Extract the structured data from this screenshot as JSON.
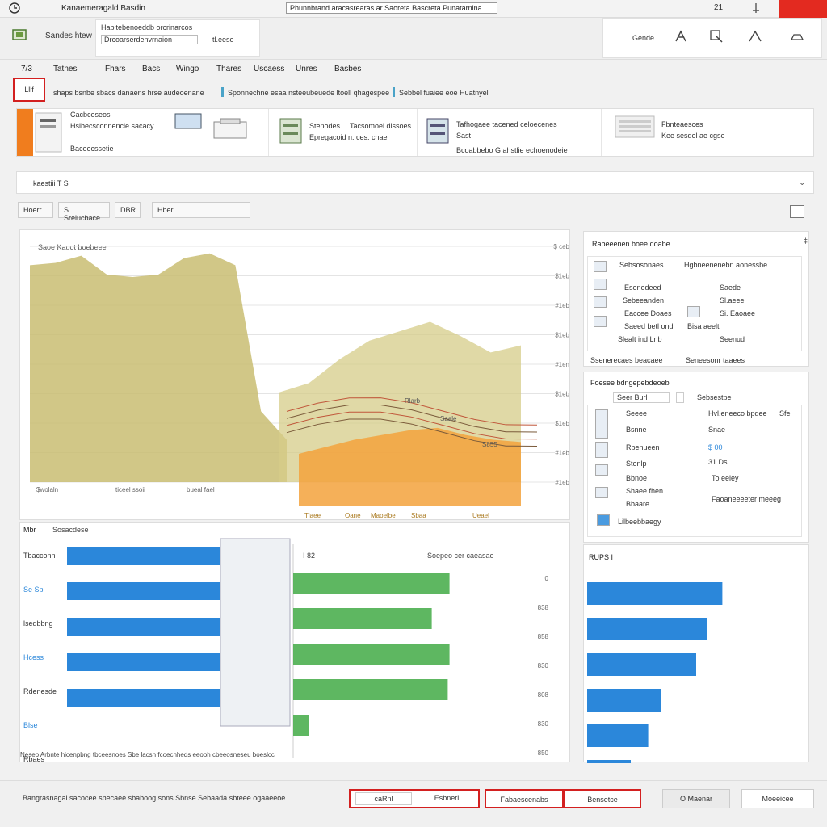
{
  "titlebar": {
    "title": "Kanaemeragald Basdin",
    "doc": "Phunnbrand aracasrearas ar Saoreta Bascreta Punatarnina",
    "num": "21"
  },
  "toolbar": {
    "label": "Sandes htew",
    "search_line1": "Habitebenoeddb orcrinarcos",
    "search_field": "Drcoarserdenvrnaion",
    "search_value": "tl.eese",
    "right_label": "Gende",
    "tools": [
      "pin-tool",
      "crop-tool",
      "angle-tool",
      "shape-tool"
    ]
  },
  "menu": [
    "Tatnes",
    "Fhars",
    "Bacs",
    "Wingo",
    "Thares",
    "Uscaess",
    "Unres",
    "Basbes"
  ],
  "menu_icon": "7/3",
  "ribbon": {
    "button": "Lllf",
    "seg1": "shaps bsnbe sbacs danaens hrse audeoenane",
    "seg2": "Sponnechne esaa nsteeubeuede ltoell qhagespee",
    "seg3": "Sebbel fuaiee eoe Huatnyel"
  },
  "cards": [
    {
      "t1": "Cacbceseos",
      "t2": "Hslbecsconnencle sacacy",
      "t3": "Baceecssetie"
    },
    {
      "t1": "Stenodes",
      "t2": "Tacsomoel dissoes",
      "t3": "Epregacoid n. ces. cnaei"
    },
    {
      "t1": "Tafhogaee tacened celoecenes",
      "t2": "Sast",
      "t3": "Bcoabbebo G ahstlie echoenodeie"
    },
    {
      "t1": "Fbnteaesces",
      "t2": "Kee sesdel ae cgse"
    }
  ],
  "section": {
    "title": "kaestiii T S"
  },
  "filters": [
    {
      "label": "Hoerr"
    },
    {
      "label": "S Srelucbace"
    },
    {
      "label": "DBR"
    },
    {
      "label": "Hber"
    }
  ],
  "mainchart": {
    "title": "Saoe  Kauot  boebeee",
    "yticks": [
      "$ ceb",
      "$1eb",
      "#1eb",
      "$1eb",
      "#1en",
      "$1eb",
      "$1eb",
      "#1eb",
      "#1eb"
    ],
    "xlabels": [
      "$wolaln",
      "ticeel ssoii",
      "bueal fael"
    ],
    "xlabels2": [
      "Tlaee",
      "Oane",
      "Maoelbe",
      "Sbaa",
      "Ueael"
    ],
    "annot1": "Rlarb",
    "annot2": "Saale",
    "annot3": "S855",
    "series_area1": [
      0.92,
      0.93,
      0.96,
      0.88,
      0.87,
      0.88,
      0.95,
      0.97,
      0.92,
      0.3,
      0.18
    ],
    "series_area2": [
      0.38,
      0.42,
      0.52,
      0.6,
      0.64,
      0.68,
      0.62,
      0.55,
      0.58
    ],
    "series_orange": [
      0.12,
      0.15,
      0.18,
      0.2,
      0.22,
      0.23,
      0.2,
      0.18,
      0.17
    ]
  },
  "panel1": {
    "title": "Rabeeenen boee doabe",
    "rows": [
      {
        "a": "Sebsosonaes",
        "b": "Hgbneenenebn aonessbe"
      },
      {
        "a": "Esenedeed",
        "b": "Saede"
      },
      {
        "a": "Sebeeanden",
        "b": "Sl.aeee"
      },
      {
        "a": "Eaccee Doaes",
        "b": "Si. Eaoaee"
      },
      {
        "a": "Saeed betl ond",
        "b": "Bisa aeelt"
      },
      {
        "a": "Slealt ind Lnb",
        "b": "Seenud"
      }
    ],
    "foot_a": "Ssenerecaes beacaee",
    "foot_b": "Seneesonr taaees"
  },
  "panel2": {
    "title": "Foesee bdngepebdeoeb",
    "chip": "Seer  Burl",
    "chip2": "Sebsestpe",
    "rows": [
      {
        "a": "Seeee",
        "b": "Hvl.eneeco bpdee",
        "c": "Sfe"
      },
      {
        "a": "Bsnne",
        "b": "Snae",
        "c": ""
      },
      {
        "a": "Rbenueen",
        "b": "$ 00",
        "c": ""
      },
      {
        "a": "Stenlp",
        "b": "31 Ds",
        "c": ""
      },
      {
        "a": "Bbnoe",
        "b": "To eeley",
        "c": ""
      },
      {
        "a": "Shaee fhen",
        "b": "Faoaneeeeter meeeg",
        "c": ""
      },
      {
        "a": "Bbaare",
        "b": "",
        "c": ""
      },
      {
        "a": "Lilbeebbaegy",
        "b": "",
        "c": ""
      }
    ]
  },
  "bottomleft": {
    "title": "Mbr",
    "subtitle": "Sosacdese",
    "mid_title": "Soepeo cer caeasae",
    "mid_left": "I 82",
    "labels": [
      "Tbacconn",
      "Se Sp",
      "lsedbbng",
      "Hcess",
      "Rdenesde",
      "Blse",
      "Rbaes"
    ],
    "blue": [
      0.9,
      0.9,
      0.9,
      0.9,
      0.9
    ],
    "green": [
      0.88,
      0.78,
      0.88,
      0.87,
      0.09
    ],
    "yvals": [
      "0",
      "838",
      "858",
      "830",
      "808",
      "830",
      "850"
    ],
    "foot": "Nesep  Arbnte  hicenpbng tbceesnoes Sbe lacsn fcoecnheds  eeooh  cbeeosneseu  boeslcc"
  },
  "bottomright": {
    "title": "RUPS I",
    "bars": [
      0.62,
      0.55,
      0.5,
      0.34,
      0.28,
      0.2
    ]
  },
  "footer": {
    "status": "Bangrasnagal sacocee sbecaee sbaboog sons Sbnse Sebaada sbteee ogaaeeoe",
    "btn1": "caRnl",
    "btn2": "Esbnerl",
    "btn3": "Fabaescenabs",
    "btn4": "Bensetce",
    "btn5": "O Maenar",
    "btn6": "Moeeicee"
  },
  "colors": {
    "accent_red": "#d32020",
    "blue": "#2b87da",
    "green": "#4caf50",
    "olive": "#c5b86e",
    "orange": "#f3a23c"
  }
}
